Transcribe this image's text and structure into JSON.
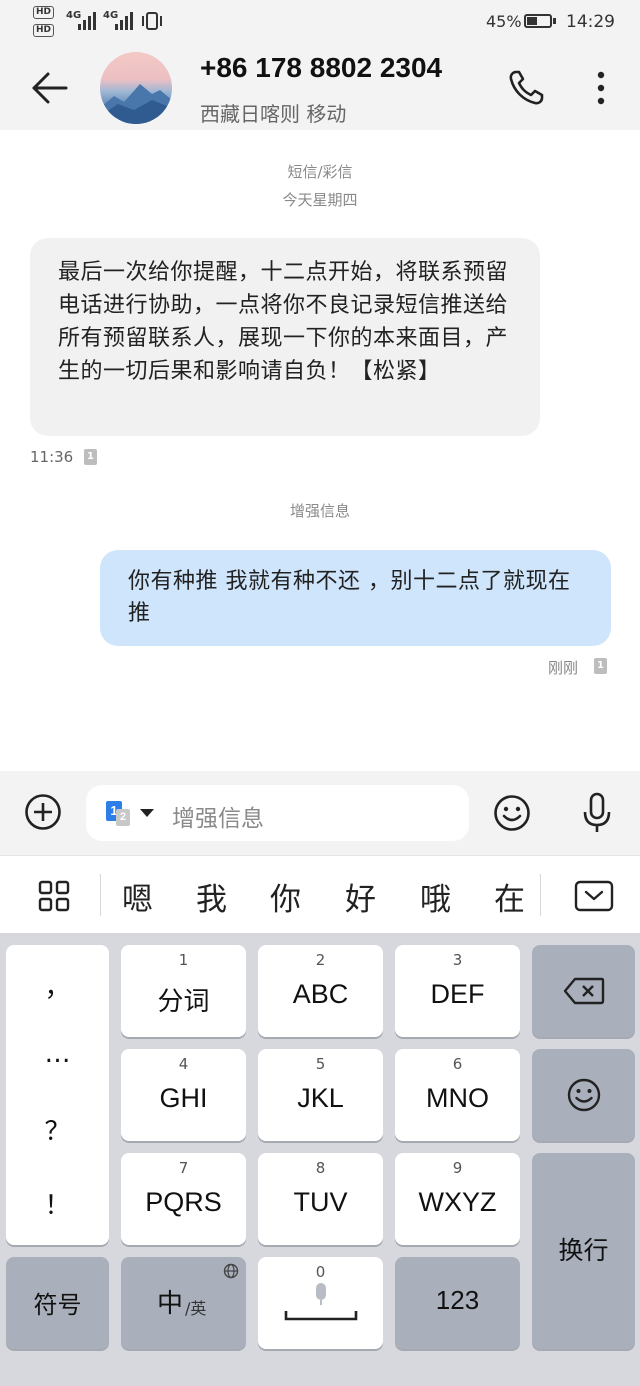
{
  "status_bar": {
    "hd1": "HD",
    "hd2": "HD",
    "sig1": "4G",
    "sig2": "4G",
    "battery_percent": "45%",
    "battery_level": 0.45,
    "time": "14:29"
  },
  "header": {
    "contact_number": "+86 178 8802 2304",
    "contact_location": "西藏日喀则 移动"
  },
  "conversation": {
    "channel_label": "短信/彩信",
    "date_label": "今天星期四",
    "incoming": {
      "text": "最后一次给你提醒，十二点开始，将联系预留电话进行协助，一点将你不良记录短信推送给所有预留联系人，展现一下你的本来面目，产生的一切后果和影响请自负！【松紧】",
      "time": "11:36",
      "sim": "1"
    },
    "enhanced_label": "增强信息",
    "outgoing": {
      "text": "你有种推  我就有种不还  ，别十二点了就现在推",
      "time": "刚刚",
      "sim": "1"
    }
  },
  "input_bar": {
    "sim_primary": "1",
    "sim_secondary": "2",
    "placeholder": "增强信息"
  },
  "candidates": [
    "嗯",
    "我",
    "你",
    "好",
    "哦",
    "在"
  ],
  "keyboard": {
    "punctuation": [
      "，",
      "…",
      "？",
      "！"
    ],
    "keys": [
      {
        "num": "1",
        "label": "分词"
      },
      {
        "num": "2",
        "label": "ABC"
      },
      {
        "num": "3",
        "label": "DEF"
      },
      {
        "num": "4",
        "label": "GHI"
      },
      {
        "num": "5",
        "label": "JKL"
      },
      {
        "num": "6",
        "label": "MNO"
      },
      {
        "num": "7",
        "label": "PQRS"
      },
      {
        "num": "8",
        "label": "TUV"
      },
      {
        "num": "9",
        "label": "WXYZ"
      }
    ],
    "symbols": "符号",
    "lang_main": "中",
    "lang_sub": "/英",
    "space_num": "0",
    "numbers": "123",
    "enter": "换行"
  }
}
